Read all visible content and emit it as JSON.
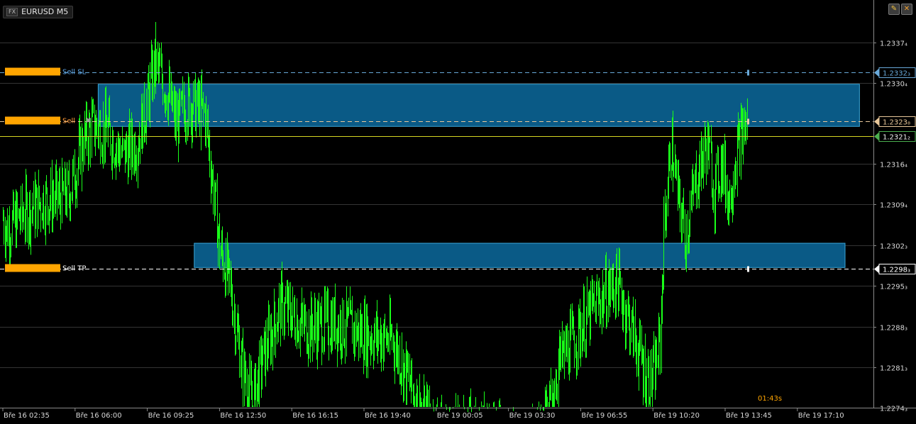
{
  "header": {
    "fx_tag": "FX",
    "symbol": "EURUSD M5",
    "countdown": "01:43s"
  },
  "icons": {
    "pencil": "pencil-icon",
    "close": "close-icon",
    "remove_order": "close-icon"
  },
  "colors": {
    "background": "#000000",
    "grid": "#343434",
    "candles": "#19ff19",
    "zone_fill": "#0a5a86",
    "zone_border": "#3aa6d8",
    "order_tag": "#ffa500",
    "sl_line": "#69a9d9",
    "entry_line": "#e9c89a",
    "bid_line": "#d6d622",
    "tp_line": "#ffffff",
    "countdown": "#ffa500"
  },
  "chart_data": {
    "type": "candlestick",
    "symbol": "EURUSD",
    "timeframe": "M5",
    "ylim": [
      1.22735,
      1.23413
    ],
    "y_ticks": [
      "1.2337₄",
      "1.2330₄",
      "1.2316₄",
      "1.2309₄",
      "1.2302₃",
      "1.2295₃",
      "1.2288₃",
      "1.2281₃",
      "1.2274₃"
    ],
    "y_tick_values": [
      1.23374,
      1.23304,
      1.23164,
      1.23094,
      1.23023,
      1.22953,
      1.22883,
      1.22813,
      1.22743
    ],
    "x_ticks": [
      "Bře 16 02:35",
      "Bře 16 06:00",
      "Bře 16 09:25",
      "Bře 16 12:50",
      "Bře 16 16:15",
      "Bře 16 19:40",
      "Bře 19 00:05",
      "Bře 19 03:30",
      "Bře 19 06:55",
      "Bře 19 10:20",
      "Bře 19 13:45",
      "Bře 19 17:10"
    ],
    "price_series": {
      "name": "EURUSD M5",
      "time_index": [
        0,
        0.05,
        0.3,
        0.55,
        0.9,
        1.0,
        1.1,
        1.25,
        1.45,
        1.65,
        1.85,
        2.0,
        2.1,
        2.3,
        2.4,
        2.5,
        2.6,
        2.8,
        3.0,
        3.15,
        3.3,
        3.45,
        3.6,
        3.85,
        4.2,
        4.6,
        5.0,
        5.4,
        5.8,
        6.0,
        6.1,
        6.2,
        6.45,
        6.8,
        7.0,
        7.3,
        7.5,
        7.7,
        8.2,
        8.5,
        8.9,
        9.0,
        9.1,
        9.15,
        9.25,
        9.35,
        9.45,
        9.6,
        9.75,
        9.85,
        9.95,
        10.05,
        10.15,
        10.3
      ],
      "close": [
        1.2307,
        1.2305,
        1.2308,
        1.231,
        1.2311,
        1.2315,
        1.232,
        1.2323,
        1.2322,
        1.2318,
        1.232,
        1.2327,
        1.2334,
        1.2328,
        1.2323,
        1.2326,
        1.2327,
        1.2325,
        1.2302,
        1.2295,
        1.2282,
        1.2275,
        1.2283,
        1.2292,
        1.2288,
        1.2289,
        1.2287,
        1.2286,
        1.2273,
        1.2271,
        1.227,
        1.2269,
        1.227,
        1.2271,
        1.2268,
        1.2268,
        1.2271,
        1.2282,
        1.2292,
        1.2296,
        1.228,
        1.2279,
        1.2286,
        1.2305,
        1.232,
        1.231,
        1.2304,
        1.2314,
        1.232,
        1.2312,
        1.2317,
        1.231,
        1.2318,
        1.2324
      ]
    },
    "zones": [
      {
        "name": "upper-zone",
        "x_from": 1.32,
        "x_to": 11.86,
        "y_from": 1.23229,
        "y_to": 1.23302
      },
      {
        "name": "lower-zone",
        "x_from": 2.65,
        "x_to": 11.66,
        "y_from": 1.22985,
        "y_to": 1.23027
      }
    ],
    "orders": [
      {
        "label": "Sell  SL",
        "price_label": "1.2332₃",
        "price": 1.23323,
        "color": "#69a9d9",
        "text_color": "#5aa0e0",
        "has_close": false
      },
      {
        "label": "Sell",
        "price_label": "1.2323₈",
        "price": 1.23238,
        "color": "#e9c89a",
        "text_color": "#ff9a3a",
        "has_close": true
      },
      {
        "label": "Sell  TP",
        "price_label": "1.2298₃",
        "price": 1.22983,
        "color": "#ffffff",
        "text_color": "#ffffff",
        "has_close": false
      }
    ],
    "bid": {
      "price_label": "1.2321₂",
      "price": 1.23212,
      "color": "#d6d622"
    }
  }
}
